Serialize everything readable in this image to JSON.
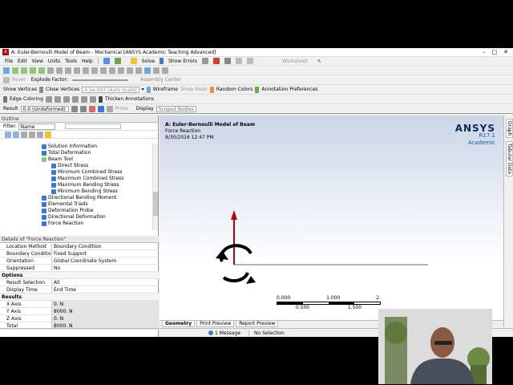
{
  "window": {
    "title": "A: Euler-Bernoulli Model of Beam - Mechanical [ANSYS Academic Teaching Advanced]",
    "minimize": "–",
    "maximize": "□",
    "close": "✕"
  },
  "menu": [
    "File",
    "Edit",
    "View",
    "Units",
    "Tools",
    "Help"
  ],
  "toolbar1": {
    "solve": "Solve",
    "show_errors": "Show Errors",
    "worksheet": "Worksheet"
  },
  "toolbar2": {},
  "toolbar3": {
    "reset": "Reset",
    "explode_factor": "Explode Factor:",
    "assembly_center": "Assembly Center"
  },
  "toolbar4": {
    "show_vertices": "Show Vertices",
    "close_vertices": "Close Vertices",
    "scale_value": "4.5e-003 (Auto Scale)",
    "wireframe": "Wireframe",
    "show_mesh": "Show Mesh",
    "random_colors": "Random Colors",
    "annotation_preferences": "Annotation Preferences"
  },
  "toolbar5": {
    "edge_coloring": "Edge Coloring",
    "thicken_annotations": "Thicken Annotations"
  },
  "toolbar6": {
    "result_label": "Result",
    "result_value": "0.0 (Undeformed)",
    "probe": "Probe",
    "display": "Display",
    "scoped_bodies": "Scoped Bodies"
  },
  "outline": {
    "header": "Outline",
    "filter_label": "Filter:",
    "filter_value": "Name",
    "items": [
      {
        "label": "Solution Information",
        "indent": 0
      },
      {
        "label": "Total Deformation",
        "indent": 0
      },
      {
        "label": "Beam Tool",
        "indent": 0
      },
      {
        "label": "Direct Stress",
        "indent": 1
      },
      {
        "label": "Minimum Combined Stress",
        "indent": 1
      },
      {
        "label": "Maximum Combined Stress",
        "indent": 1
      },
      {
        "label": "Maximum Bending Stress",
        "indent": 1
      },
      {
        "label": "Minimum Bending Stress",
        "indent": 1
      },
      {
        "label": "Directional Bending Moment",
        "indent": 0
      },
      {
        "label": "Elemental Triads",
        "indent": 0
      },
      {
        "label": "Deformation Probe",
        "indent": 0
      },
      {
        "label": "Directional Deformation",
        "indent": 0
      },
      {
        "label": "Force Reaction",
        "indent": 0
      }
    ]
  },
  "details": {
    "header": "Details of \"Force Reaction\"",
    "rows": [
      {
        "k": "Location Method",
        "v": "Boundary Condition",
        "type": "row"
      },
      {
        "k": "Boundary Condition",
        "v": "Fixed Support",
        "type": "row"
      },
      {
        "k": "Orientation",
        "v": "Global Coordinate System",
        "type": "row"
      },
      {
        "k": "Suppressed",
        "v": "No",
        "type": "row"
      },
      {
        "k": "Options",
        "v": "",
        "type": "sec"
      },
      {
        "k": "Result Selection",
        "v": "All",
        "type": "row"
      },
      {
        "k": "Display Time",
        "v": "End Time",
        "type": "row"
      },
      {
        "k": "Results",
        "v": "",
        "type": "sec"
      },
      {
        "k": "X Axis",
        "v": "0. N",
        "type": "gray"
      },
      {
        "k": "Y Axis",
        "v": "8000. N",
        "type": "gray"
      },
      {
        "k": "Z Axis",
        "v": "0. N",
        "type": "gray"
      },
      {
        "k": "Total",
        "v": "8000. N",
        "type": "gray"
      }
    ]
  },
  "viewport": {
    "model_title": "A: Euler-Bernoulli Model of Beam",
    "result_name": "Force Reaction",
    "timestamp": "8/30/2016 12:47 PM",
    "brand": "ANSYS",
    "version": "R17.1",
    "edition": "Academic",
    "scale_top": [
      "0.000",
      "1.000",
      "2."
    ],
    "scale_bottom": [
      "0.500",
      "1.500"
    ]
  },
  "tabs": [
    "Geometry",
    "Print Preview",
    "Report Preview"
  ],
  "side_tabs": [
    "Graph",
    "Tabular Data"
  ],
  "status": {
    "messages": "1 Message",
    "selection": "No Selection"
  },
  "colors": {
    "accent": "#0a5fa8",
    "rotate_icon": "#000000",
    "y_arrow": "#c00000"
  }
}
